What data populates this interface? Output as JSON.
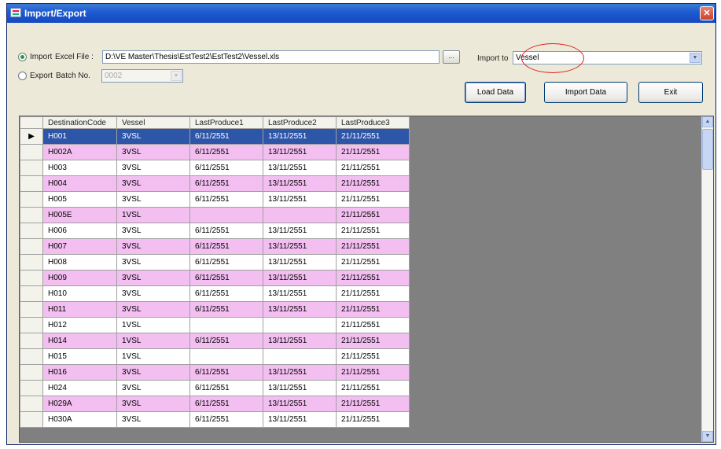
{
  "window": {
    "title": "Import/Export"
  },
  "import_section": {
    "import_radio_label": "Import",
    "excel_file_label": "Excel File :",
    "excel_file_path": "D:\\VE Master\\Thesis\\EstTest2\\EstTest2\\Vessel.xls",
    "browse_label": "...",
    "export_radio_label": "Export",
    "batch_no_label": "Batch No.",
    "batch_no_value": "0002",
    "import_to_label": "Import to",
    "import_to_value": "Vessel"
  },
  "buttons": {
    "load_data": "Load Data",
    "import_data": "Import Data",
    "exit": "Exit"
  },
  "grid": {
    "columns": [
      "DestinationCode",
      "Vessel",
      "LastProduce1",
      "LastProduce2",
      "LastProduce3"
    ],
    "row_indicator": "▶",
    "rows": [
      [
        "H001",
        "3VSL",
        "6/11/2551",
        "13/11/2551",
        "21/11/2551"
      ],
      [
        "H002A",
        "3VSL",
        "6/11/2551",
        "13/11/2551",
        "21/11/2551"
      ],
      [
        "H003",
        "3VSL",
        "6/11/2551",
        "13/11/2551",
        "21/11/2551"
      ],
      [
        "H004",
        "3VSL",
        "6/11/2551",
        "13/11/2551",
        "21/11/2551"
      ],
      [
        "H005",
        "3VSL",
        "6/11/2551",
        "13/11/2551",
        "21/11/2551"
      ],
      [
        "H005E",
        "1VSL",
        "",
        "",
        "21/11/2551"
      ],
      [
        "H006",
        "3VSL",
        "6/11/2551",
        "13/11/2551",
        "21/11/2551"
      ],
      [
        "H007",
        "3VSL",
        "6/11/2551",
        "13/11/2551",
        "21/11/2551"
      ],
      [
        "H008",
        "3VSL",
        "6/11/2551",
        "13/11/2551",
        "21/11/2551"
      ],
      [
        "H009",
        "3VSL",
        "6/11/2551",
        "13/11/2551",
        "21/11/2551"
      ],
      [
        "H010",
        "3VSL",
        "6/11/2551",
        "13/11/2551",
        "21/11/2551"
      ],
      [
        "H011",
        "3VSL",
        "6/11/2551",
        "13/11/2551",
        "21/11/2551"
      ],
      [
        "H012",
        "1VSL",
        "",
        "",
        "21/11/2551"
      ],
      [
        "H014",
        "1VSL",
        "6/11/2551",
        "13/11/2551",
        "21/11/2551"
      ],
      [
        "H015",
        "1VSL",
        "",
        "",
        "21/11/2551"
      ],
      [
        "H016",
        "3VSL",
        "6/11/2551",
        "13/11/2551",
        "21/11/2551"
      ],
      [
        "H024",
        "3VSL",
        "6/11/2551",
        "13/11/2551",
        "21/11/2551"
      ],
      [
        "H029A",
        "3VSL",
        "6/11/2551",
        "13/11/2551",
        "21/11/2551"
      ],
      [
        "H030A",
        "3VSL",
        "6/11/2551",
        "13/11/2551",
        "21/11/2551"
      ]
    ]
  },
  "scrollbar": {
    "up": "▲",
    "down": "▼"
  },
  "dropdown_arrow": "▼",
  "icons": {
    "window-icon": "app",
    "close-icon": "✕"
  },
  "colors": {
    "selected_row": "#2e56a8",
    "alt_row": "#f3bff1",
    "title_bar": "#1d5ad0",
    "highlight": "#e02020"
  }
}
